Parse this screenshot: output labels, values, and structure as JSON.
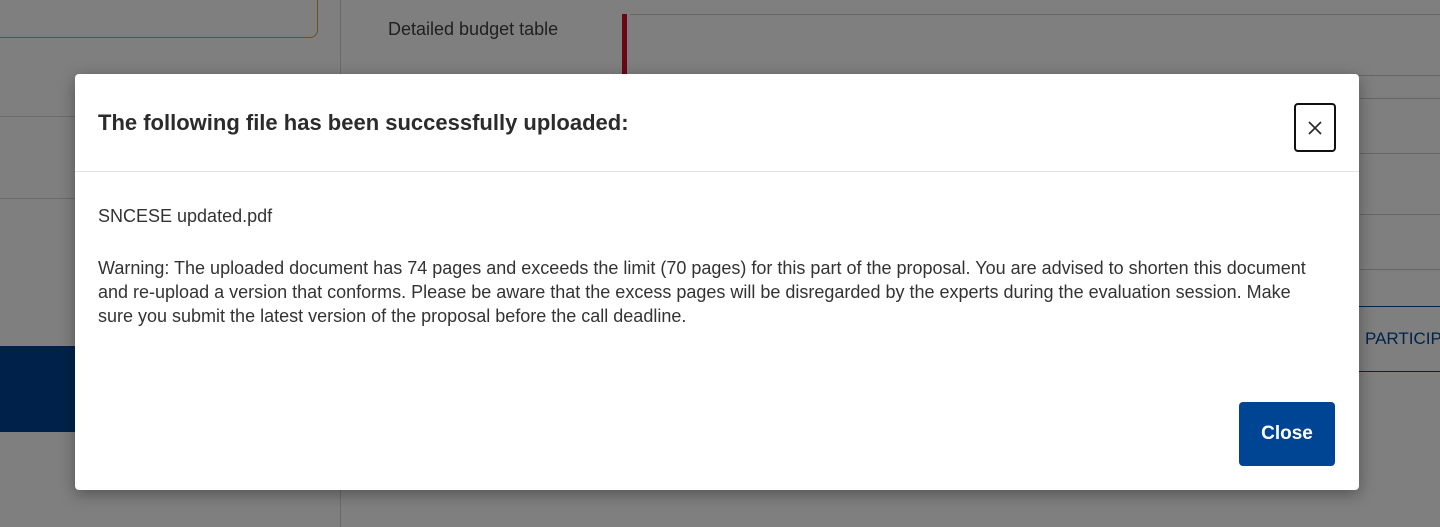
{
  "background": {
    "budget_label": "Detailed budget table",
    "participants_button": "PARTICIPANTS LIST"
  },
  "modal": {
    "title": "The following file has been successfully uploaded:",
    "file_name": "SNCESE updated.pdf",
    "warning": "Warning: The uploaded document has 74 pages and exceeds the limit (70 pages) for this part of the proposal. You are advised to shorten this document and re-upload a version that conforms. Please be aware that the excess pages will be disregarded by the experts during the evaluation session. Make sure you submit the latest version of the proposal before the call deadline.",
    "close_label": "Close",
    "close_icon": "close-icon"
  },
  "colors": {
    "primary": "#004494",
    "overlay": "rgba(0,0,0,0.5)",
    "required_marker": "#d1112a"
  }
}
